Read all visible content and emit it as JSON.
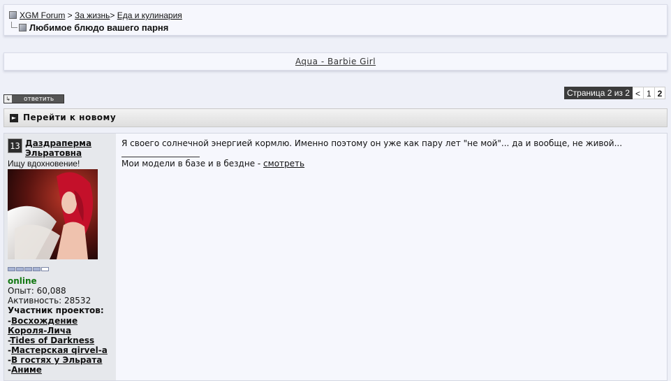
{
  "breadcrumb": {
    "forum": "XGM Forum",
    "sep1": " > ",
    "section": "За жизнь",
    "sep2": "> ",
    "subsection": "Еда и кулинария",
    "thread_title": "Любимое блюдо вашего парня"
  },
  "music": {
    "label": "Aqua - Barbie Girl"
  },
  "toolbar": {
    "reply_label": "ответить"
  },
  "pagination": {
    "info": "Страница 2 из 2",
    "prev": "<",
    "pages": [
      "1",
      "2"
    ],
    "current": "2"
  },
  "goto_new": {
    "label": "Перейти к новому"
  },
  "post": {
    "user": {
      "level": "13",
      "name": "Даздраперма Эльратовна",
      "title": "Ищу вдохновение!",
      "rank": {
        "filled": 4,
        "total": 5
      },
      "status": "online",
      "experience": "Опыт: 60,088",
      "activity": "Активность: 28532",
      "projects_title": "Участник проектов:",
      "projects": [
        "Восхождение Короля-Лича",
        "Tides of Darkness",
        "Мастерская qirvel-a",
        "В гостях у Эльрата",
        "Аниме"
      ]
    },
    "message": "Я своего солнечной энергией кормлю. Именно поэтому он уже как пару лет \"не мой\"... да и вообще, не живой...",
    "signature": {
      "text": "Мои модели в базе и в бездне - ",
      "link": "смотреть"
    }
  },
  "colors": {
    "page_bg": "#eef0f8",
    "online": "#117711",
    "pager_dark": "#3b3b3b"
  }
}
